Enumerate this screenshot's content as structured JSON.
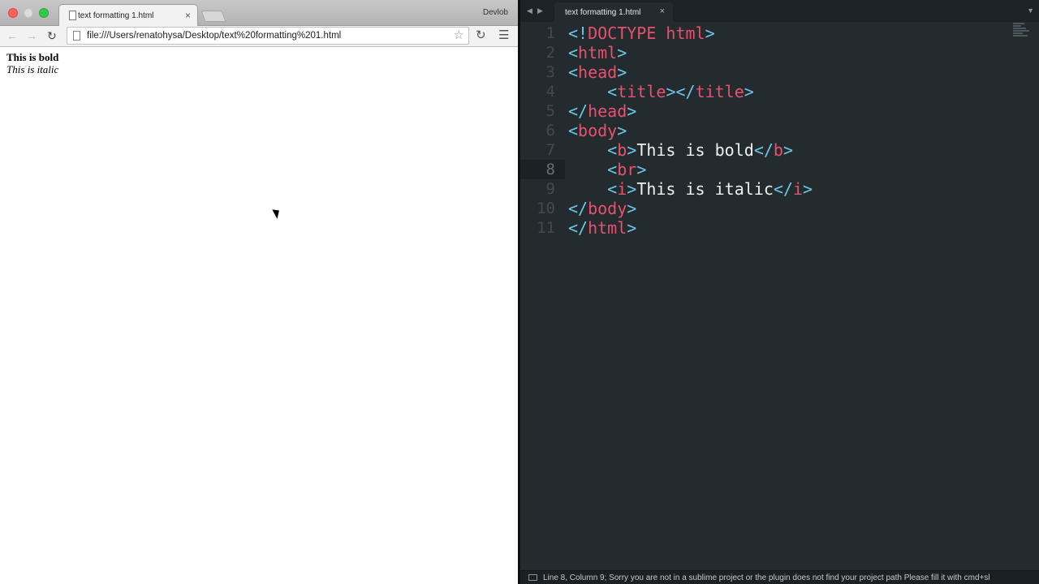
{
  "browser": {
    "tab_title": "text formatting 1.html",
    "tab_close": "×",
    "profile_name": "Devlob",
    "url": "file:///Users/renatohysa/Desktop/text%20formatting%201.html",
    "page": {
      "bold_text": "This is bold",
      "italic_text": "This is italic"
    }
  },
  "editor": {
    "tab_title": "text formatting 1.html",
    "tab_close": "×",
    "current_line": 8,
    "lines": [
      {
        "n": "1",
        "segments": [
          [
            "<!",
            "tagp"
          ],
          [
            "DOCTYPE html",
            "tagn"
          ],
          [
            ">",
            "tagp"
          ]
        ]
      },
      {
        "n": "2",
        "segments": [
          [
            "<",
            "tagp"
          ],
          [
            "html",
            "tagn"
          ],
          [
            ">",
            "tagp"
          ]
        ]
      },
      {
        "n": "3",
        "segments": [
          [
            "<",
            "tagp"
          ],
          [
            "head",
            "tagn"
          ],
          [
            ">",
            "tagp"
          ]
        ]
      },
      {
        "n": "4",
        "segments": [
          [
            "    <",
            "tagp"
          ],
          [
            "title",
            "tagn"
          ],
          [
            "></",
            "tagp"
          ],
          [
            "title",
            "tagn"
          ],
          [
            ">",
            "tagp"
          ]
        ]
      },
      {
        "n": "5",
        "segments": [
          [
            "</",
            "tagp"
          ],
          [
            "head",
            "tagn"
          ],
          [
            ">",
            "tagp"
          ]
        ]
      },
      {
        "n": "6",
        "segments": [
          [
            "<",
            "tagp"
          ],
          [
            "body",
            "tagn"
          ],
          [
            ">",
            "tagp"
          ]
        ]
      },
      {
        "n": "7",
        "segments": [
          [
            "    <",
            "tagp"
          ],
          [
            "b",
            "tagn"
          ],
          [
            ">",
            "tagp"
          ],
          [
            "This is bold",
            "txt"
          ],
          [
            "</",
            "tagp"
          ],
          [
            "b",
            "tagn"
          ],
          [
            ">",
            "tagp"
          ]
        ]
      },
      {
        "n": "8",
        "segments": [
          [
            "    <",
            "tagp"
          ],
          [
            "br",
            "tagn"
          ],
          [
            ">",
            "tagp"
          ]
        ]
      },
      {
        "n": "9",
        "segments": [
          [
            "    <",
            "tagp"
          ],
          [
            "i",
            "tagn"
          ],
          [
            ">",
            "tagp"
          ],
          [
            "This is italic",
            "txt"
          ],
          [
            "</",
            "tagp"
          ],
          [
            "i",
            "tagn"
          ],
          [
            ">",
            "tagp"
          ]
        ]
      },
      {
        "n": "10",
        "segments": [
          [
            "</",
            "tagp"
          ],
          [
            "body",
            "tagn"
          ],
          [
            ">",
            "tagp"
          ]
        ]
      },
      {
        "n": "11",
        "segments": [
          [
            "</",
            "tagp"
          ],
          [
            "html",
            "tagn"
          ],
          [
            ">",
            "tagp"
          ]
        ]
      }
    ],
    "status_text": "Line 8, Column 9; Sorry you are not in a sublime project or the plugin does not find your project path   Please fill it with cmd+sl"
  },
  "colors": {
    "tag_punct": "#6bc8e6",
    "tag_name": "#e8516e",
    "editor_bg": "#232b2f"
  },
  "icons": {
    "back": "◀",
    "forward": "▶",
    "reload": "↻",
    "star": "☆",
    "menu": "≡"
  }
}
